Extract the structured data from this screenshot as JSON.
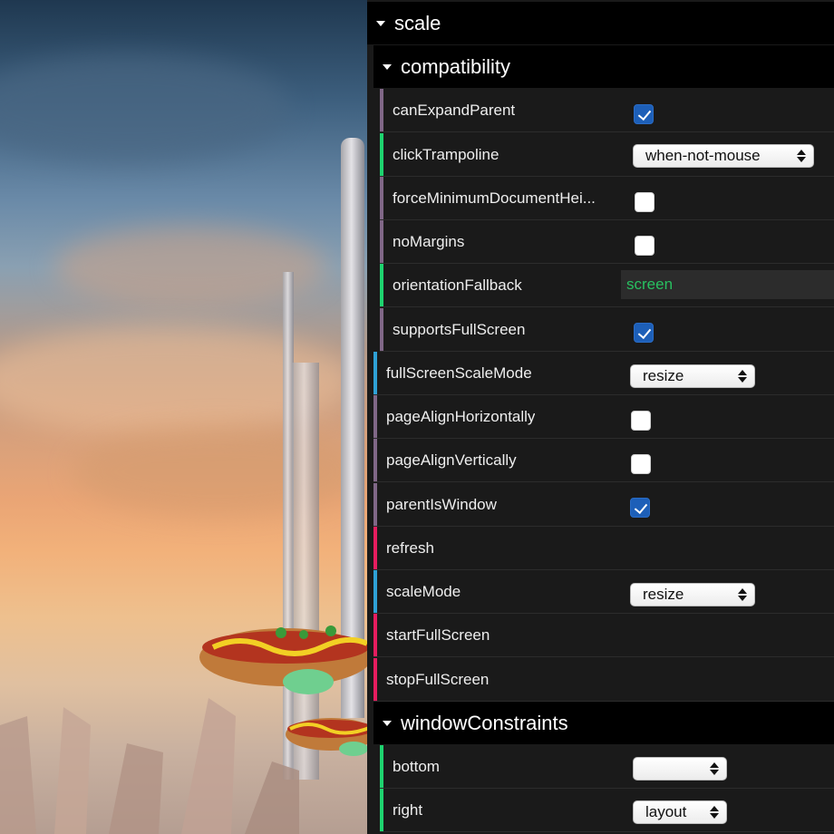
{
  "colors": {
    "bool_bar": "#806787",
    "string_bar": "#1ed36f",
    "number_bar": "#2fa1d6",
    "function_bar": "#e61d5f",
    "checkbox_checked": "#1d5fb8",
    "text_value": "#28c060"
  },
  "scale": {
    "title": "scale",
    "compatibility": {
      "title": "compatibility",
      "rows": [
        {
          "label": "canExpandParent",
          "control": "checkbox",
          "checked": true
        },
        {
          "label": "clickTrampoline",
          "control": "select",
          "value": "when-not-mouse"
        },
        {
          "label": "forceMinimumDocumentHei...",
          "control": "checkbox",
          "checked": false
        },
        {
          "label": "noMargins",
          "control": "checkbox",
          "checked": false
        },
        {
          "label": "orientationFallback",
          "control": "text",
          "value": "screen"
        },
        {
          "label": "supportsFullScreen",
          "control": "checkbox",
          "checked": true
        }
      ]
    },
    "rows": [
      {
        "label": "fullScreenScaleMode",
        "control": "select",
        "value": "resize"
      },
      {
        "label": "pageAlignHorizontally",
        "control": "checkbox",
        "checked": false
      },
      {
        "label": "pageAlignVertically",
        "control": "checkbox",
        "checked": false
      },
      {
        "label": "parentIsWindow",
        "control": "checkbox",
        "checked": true
      },
      {
        "label": "refresh",
        "control": "function"
      },
      {
        "label": "scaleMode",
        "control": "select",
        "value": "resize"
      },
      {
        "label": "startFullScreen",
        "control": "function"
      },
      {
        "label": "stopFullScreen",
        "control": "function"
      }
    ],
    "windowConstraints": {
      "title": "windowConstraints",
      "rows": [
        {
          "label": "bottom",
          "control": "select",
          "value": ""
        },
        {
          "label": "right",
          "control": "select",
          "value": "layout"
        }
      ]
    }
  }
}
